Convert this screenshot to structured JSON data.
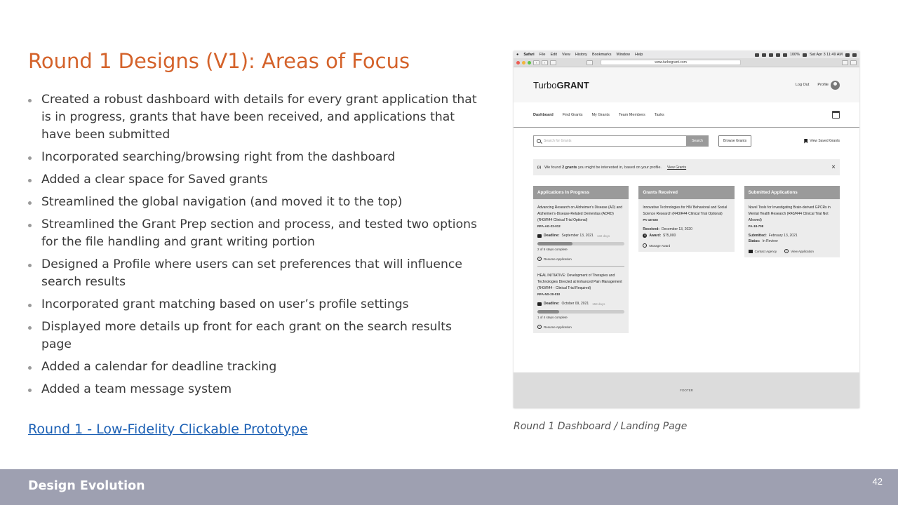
{
  "slide": {
    "title": "Round 1 Designs (V1): Areas of Focus",
    "bullets": [
      "Created a robust dashboard with details for every grant application that is in progress, grants that have been received, and applications that have been submitted",
      "Incorporated searching/browsing right from the dashboard",
      "Added a clear space for Saved grants",
      "Streamlined the global navigation (and moved it to the top)",
      "Streamlined the Grant Prep section and process, and tested two options for the file handling and grant writing portion",
      "Designed a Profile where users can set preferences that will influence search results",
      "Incorporated grant matching based on user’s profile settings",
      "Displayed more details up front for each grant on the search results page",
      "Added a calendar for deadline tracking",
      "Added a team message system"
    ],
    "link_text": "Round 1 - Low-Fidelity Clickable Prototype",
    "caption": "Round 1 Dashboard / Landing Page",
    "footer_label": "Design Evolution",
    "page_number": "42"
  },
  "mac": {
    "menu": [
      "Safari",
      "File",
      "Edit",
      "View",
      "History",
      "Bookmarks",
      "Window",
      "Help"
    ],
    "battery": "100%",
    "clock": "Sat Apr 3  11:49 AM",
    "url": "www.turbogrant.com"
  },
  "app": {
    "logo_light": "Turbo",
    "logo_bold": "GRANT",
    "logout": "Log Out",
    "profile": "Profile",
    "nav": [
      "Dashboard",
      "Find Grants",
      "My Grants",
      "Team Members",
      "Tasks"
    ],
    "search_placeholder": "Search for Grants",
    "search_button": "Search",
    "browse_button": "Browse Grants",
    "saved_link": "View Saved Grants",
    "alert": {
      "icon": "(•)",
      "pre": "We found ",
      "count": "2 grants",
      "post": " you might be interested in, based on your profile.",
      "link": "View Grants"
    },
    "cards": {
      "in_progress": {
        "header": "Applications In Progress",
        "items": [
          {
            "title": "Advancing Research on Alzheimer’s Disease (AD) and Alzheimer’s-Disease-Related Dementias (ADRD) (R43/R44 Clinical Trial Optional)",
            "code": "RFA-AG-22-012",
            "deadline_label": "Deadline:",
            "deadline": "September 13, 2021",
            "days": "132 days",
            "progress": 0.4,
            "steps": "2 of 5 steps complete",
            "action": "Resume Application"
          },
          {
            "title": "HEAL INITIATIVE: Development of Therapies and Technologies Directed at Enhanced Pain Management (R43/R44 - Clinical Trial Required)",
            "code": "RFA-NS-20-010",
            "deadline_label": "Deadline:",
            "deadline": "October 09, 2021",
            "days": "158 days",
            "progress": 0.25,
            "steps": "1 of 4 steps complete",
            "action": "Resume Application"
          }
        ]
      },
      "received": {
        "header": "Grants Received",
        "title": "Innovative Technologies for HIV Behavioral and Social Science Research (R43/R44 Clinical Trial Optional)",
        "code": "PA-18-928",
        "received_label": "Received:",
        "received": "December 13, 2020",
        "award_label": "Award:",
        "award": "$75,000",
        "action": "Manage Award"
      },
      "submitted": {
        "header": "Submitted Applications",
        "title": "Novel Tools for Investigating Brain-derived GPCRs in Mental Health Research (R43/R44 Clinical Trial Not Allowed)",
        "code": "PA-18-708",
        "submitted_label": "Submitted:",
        "submitted": "February 13, 2021",
        "status_label": "Status:",
        "status": "In Review",
        "contact": "Contact Agency",
        "view": "View Application"
      }
    },
    "footer": "FOOTER"
  }
}
